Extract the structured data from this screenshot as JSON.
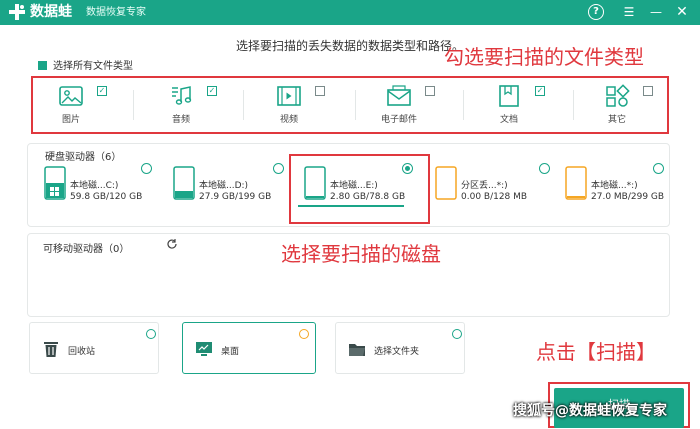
{
  "app": {
    "name": "数据蛙",
    "subtitle": "数据恢复专家",
    "help_label": "?",
    "menu_label": "☰",
    "minimize_label": "—",
    "close_label": "✕"
  },
  "heading": "选择要扫描的丢失数据的数据类型和路径。",
  "select_all_label": "选择所有文件类型",
  "file_types": [
    {
      "label": "图片",
      "icon": "image-icon",
      "checked": true
    },
    {
      "label": "音频",
      "icon": "music-icon",
      "checked": true
    },
    {
      "label": "视频",
      "icon": "video-icon",
      "checked": false
    },
    {
      "label": "电子邮件",
      "icon": "mail-icon",
      "checked": false
    },
    {
      "label": "文档",
      "icon": "document-icon",
      "checked": true
    },
    {
      "label": "其它",
      "icon": "other-icon",
      "checked": false
    }
  ],
  "hard_drives": {
    "title": "硬盘驱动器（6）",
    "items": [
      {
        "name": "本地磁...C:)",
        "size": "59.8 GB/120 GB",
        "selected": false
      },
      {
        "name": "本地磁...D:)",
        "size": "27.9 GB/199 GB",
        "selected": false
      },
      {
        "name": "本地磁...E:)",
        "size": "2.80 GB/78.8 GB",
        "selected": true
      },
      {
        "name": "分区丢...*:)",
        "size": "0.00  B/128 MB",
        "selected": false
      },
      {
        "name": "本地磁...*:)",
        "size": "27.0 MB/299 GB",
        "selected": false
      }
    ]
  },
  "removable": {
    "title": "可移动驱动器（0）",
    "refresh_icon": "refresh-icon"
  },
  "locations": [
    {
      "label": "回收站",
      "icon": "trash-icon",
      "selected": false
    },
    {
      "label": "桌面",
      "icon": "desktop-icon",
      "selected": true
    },
    {
      "label": "选择文件夹",
      "icon": "folder-icon",
      "selected": false
    }
  ],
  "scan_label": "扫描",
  "annotations": {
    "file_types": "勾选要扫描的文件类型",
    "disk": "选择要扫描的磁盘",
    "click_scan": "点击【扫描】"
  },
  "watermark": "搜狐号@数据蛙恢复专家",
  "colors": {
    "accent": "#1aa588",
    "annotation": "#e0383e",
    "warning": "#f5a623"
  }
}
